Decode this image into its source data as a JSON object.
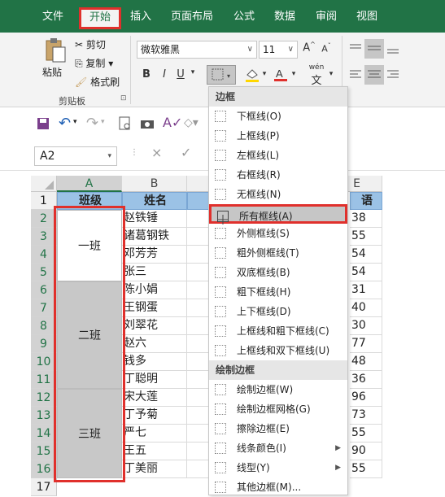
{
  "ribbon_tabs": [
    "文件",
    "开始",
    "插入",
    "页面布局",
    "公式",
    "数据",
    "审阅",
    "视图"
  ],
  "active_tab": "开始",
  "clipboard": {
    "paste": "粘贴",
    "cut": "剪切",
    "copy": "复制",
    "format_painter": "格式刷",
    "group_label": "剪贴板"
  },
  "font": {
    "name": "微软雅黑",
    "size": "11",
    "bold": "B",
    "italic": "I",
    "underline": "U",
    "grow": "A",
    "shrink": "A",
    "pinyin": "wén"
  },
  "namebox": "A2",
  "formula_icons": {
    "cancel": "×",
    "enter": "✓"
  },
  "columns": [
    "A",
    "B",
    "E"
  ],
  "rows": [
    "1",
    "2",
    "3",
    "4",
    "5",
    "6",
    "7",
    "8",
    "9",
    "10",
    "11",
    "12",
    "13",
    "14",
    "15",
    "16",
    "17"
  ],
  "header": {
    "A": "班级",
    "B": "姓名",
    "E": "语"
  },
  "classes": [
    "一班",
    "二班",
    "三班"
  ],
  "names": [
    "赵铁锤",
    "诸葛钢铁",
    "邓芳芳",
    "张三",
    "陈小娟",
    "王钢蛋",
    "刘翠花",
    "赵六",
    "钱多",
    "丁聪明",
    "宋大莲",
    "丁予菊",
    "严七",
    "王五",
    "丁美丽"
  ],
  "scores": [
    "38",
    "55",
    "54",
    "54",
    "31",
    "40",
    "30",
    "77",
    "48",
    "36",
    "96",
    "73",
    "55",
    "90",
    "55"
  ],
  "menu": {
    "section_borders": "边框",
    "items_borders": [
      "下框线(O)",
      "上框线(P)",
      "左框线(L)",
      "右框线(R)",
      "无框线(N)",
      "所有框线(A)",
      "外侧框线(S)",
      "粗外侧框线(T)",
      "双底框线(B)",
      "粗下框线(H)",
      "上下框线(D)",
      "上框线和粗下框线(C)",
      "上框线和双下框线(U)"
    ],
    "section_draw": "绘制边框",
    "items_draw": [
      "绘制边框(W)",
      "绘制边框网格(G)",
      "擦除边框(E)",
      "线条颜色(I)",
      "线型(Y)",
      "其他边框(M)..."
    ],
    "highlighted": "所有框线(A)"
  },
  "colors": {
    "ribbon_green": "#217346",
    "header_blue": "#9bc2e6",
    "merged_gray": "#c8c8c8",
    "highlight_red": "#e0302c"
  }
}
